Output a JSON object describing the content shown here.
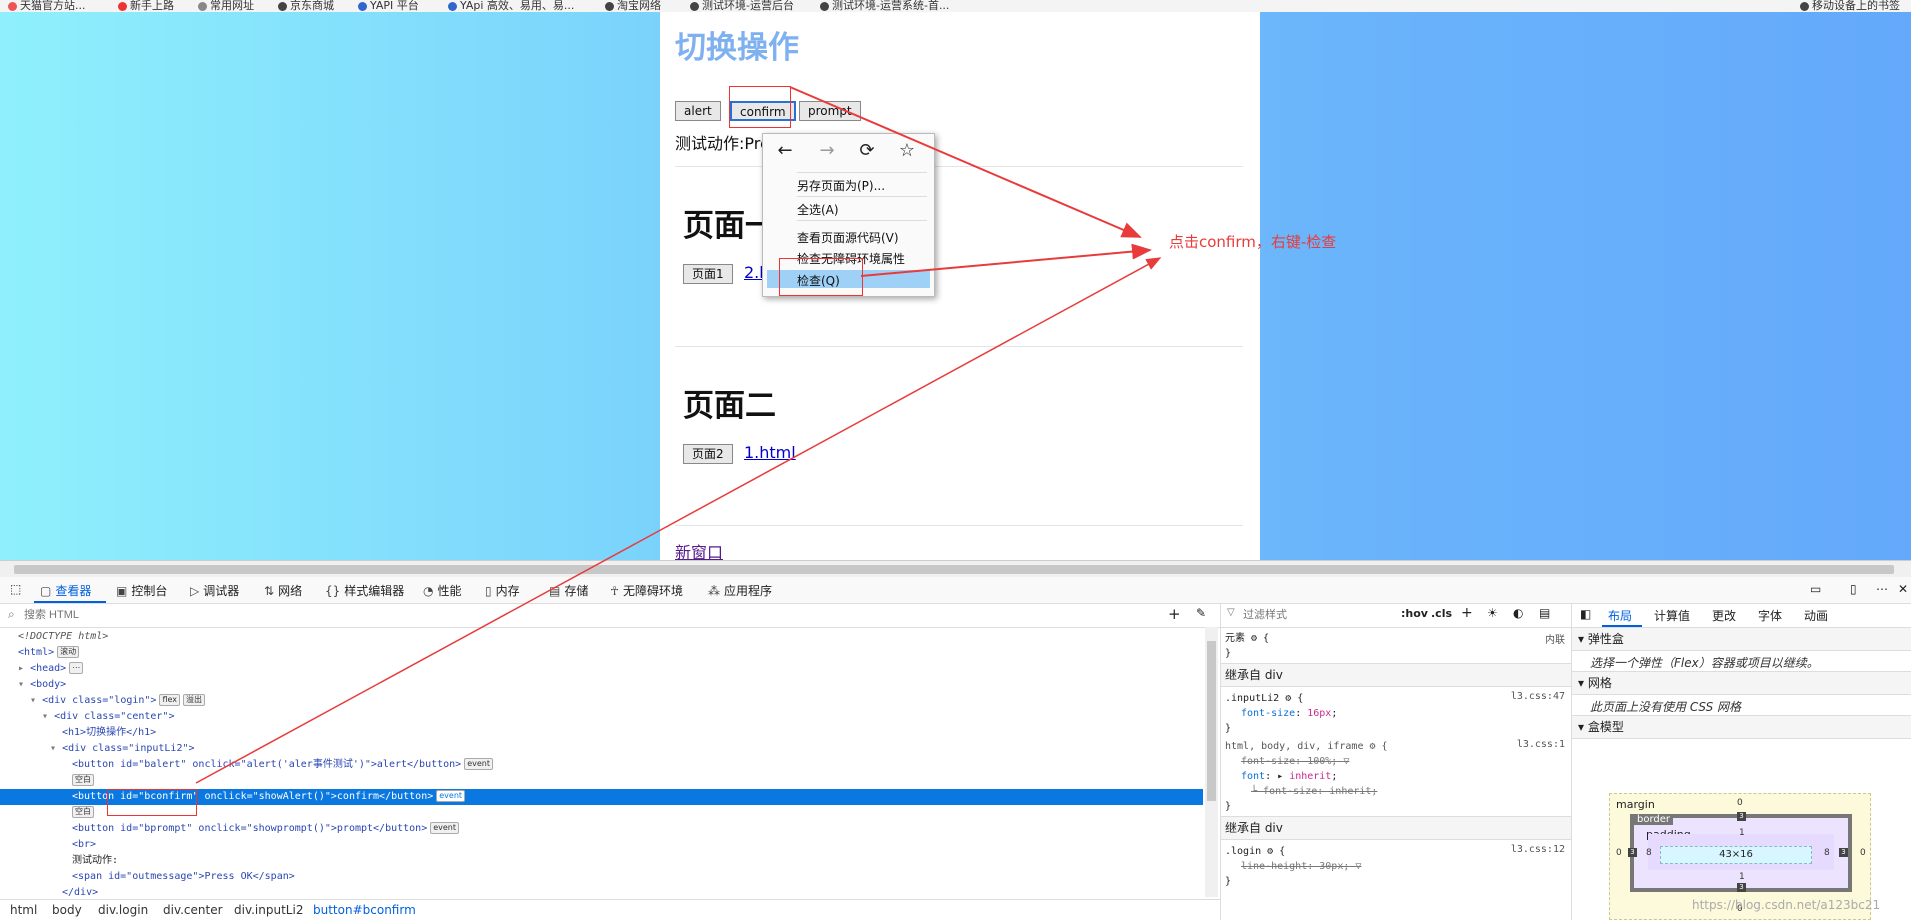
{
  "bookmarks": [
    "天猫官方站...",
    "新手上路",
    "常用网址",
    "京东商城",
    "YAPI 平台",
    "YApi 高效、易用、易...",
    "淘宝网络",
    "测试环境-运营后台",
    "测试环境-运营系统-首...",
    "移动设备上的书签"
  ],
  "page": {
    "title": "切换操作",
    "buttons": {
      "alert": "alert",
      "confirm": "confirm",
      "prompt": "prompt"
    },
    "output_text": "测试动作:Press OK",
    "section1": {
      "heading": "页面一",
      "button": "页面1",
      "link": "2.html"
    },
    "section2": {
      "heading": "页面二",
      "button": "页面2",
      "link": "1.html"
    },
    "new_window_link": "新窗口"
  },
  "context_menu": {
    "items": [
      "另存页面为(P)...",
      "全选(A)",
      "查看页面源代码(V)",
      "检查无障碍环境属性",
      "检查(Q)"
    ],
    "highlighted": "检查(Q)"
  },
  "annotation": "点击confirm，右键-检查",
  "devtools": {
    "tabs": [
      "查看器",
      "控制台",
      "调试器",
      "网络",
      "样式编辑器",
      "性能",
      "内存",
      "存储",
      "无障碍环境",
      "应用程序"
    ],
    "active_tab": "查看器",
    "search_placeholder": "搜索 HTML",
    "markup": [
      "<!DOCTYPE html>",
      "<html>",
      "<head>",
      "<body>",
      "<div class=\"login\">",
      "<div class=\"center\">",
      "<h1>切换操作</h1>",
      "<div class=\"inputLi2\">",
      "<button id=\"balert\" onclick=\"alert('aler事件测试')\">alert</button>",
      "空白",
      "<button id=\"bconfirm\" onclick=\"showAlert()\">confirm</button>",
      "空白",
      "<button id=\"bprompt\" onclick=\"showprompt()\">prompt</button>",
      "<br>",
      "测试动作:",
      "<span id=\"outmessage\">Press OK</span>",
      "</div>"
    ],
    "badges": {
      "scroll": "滚动",
      "flex": "flex",
      "overflow": "溢出",
      "event": "event"
    },
    "breadcrumb": [
      "html",
      "body",
      "div.login",
      "div.center",
      "div.inputLi2",
      "button#bconfirm"
    ],
    "rules": {
      "filter_placeholder": "过滤样式",
      "hov": ":hov",
      "cls": ".cls",
      "element": "元素",
      "inline": "内联",
      "inherited1": "继承自 div",
      "inputLi2_selector": ".inputLi2",
      "inputLi2_src": "l3.css:47",
      "inputLi2_prop": "font-size",
      "inputLi2_val": "16px",
      "html_selector": "html, body, div, iframe",
      "html_src": "l3.css:1",
      "html_prop1": "font-size: 100%;",
      "html_prop2": "font",
      "html_val2": "inherit",
      "html_prop3": "font-size: inherit;",
      "inherited2": "继承自 div",
      "login_selector": ".login",
      "login_src": "l3.css:12",
      "login_prop": "line-height: 30px;"
    },
    "layout": {
      "tabs": [
        "布局",
        "计算值",
        "更改",
        "字体",
        "动画"
      ],
      "active_tab": "布局",
      "flexbox": "弹性盒",
      "flexbox_note": "选择一个弹性（Flex）容器或项目以继续。",
      "grid": "网格",
      "grid_note": "此页面上没有使用 CSS 网格",
      "boxmodel": "盒模型",
      "margin_label": "margin",
      "border_label": "border",
      "padding_label": "padding",
      "content_size": "43×16",
      "margin_vals": [
        "0",
        "0",
        "0",
        "0"
      ],
      "border_vals": [
        "3",
        "3",
        "3",
        "3"
      ],
      "padding_vals": [
        "1",
        "8",
        "1",
        "8"
      ]
    }
  },
  "watermark": "https://blog.csdn.net/a123bc21"
}
